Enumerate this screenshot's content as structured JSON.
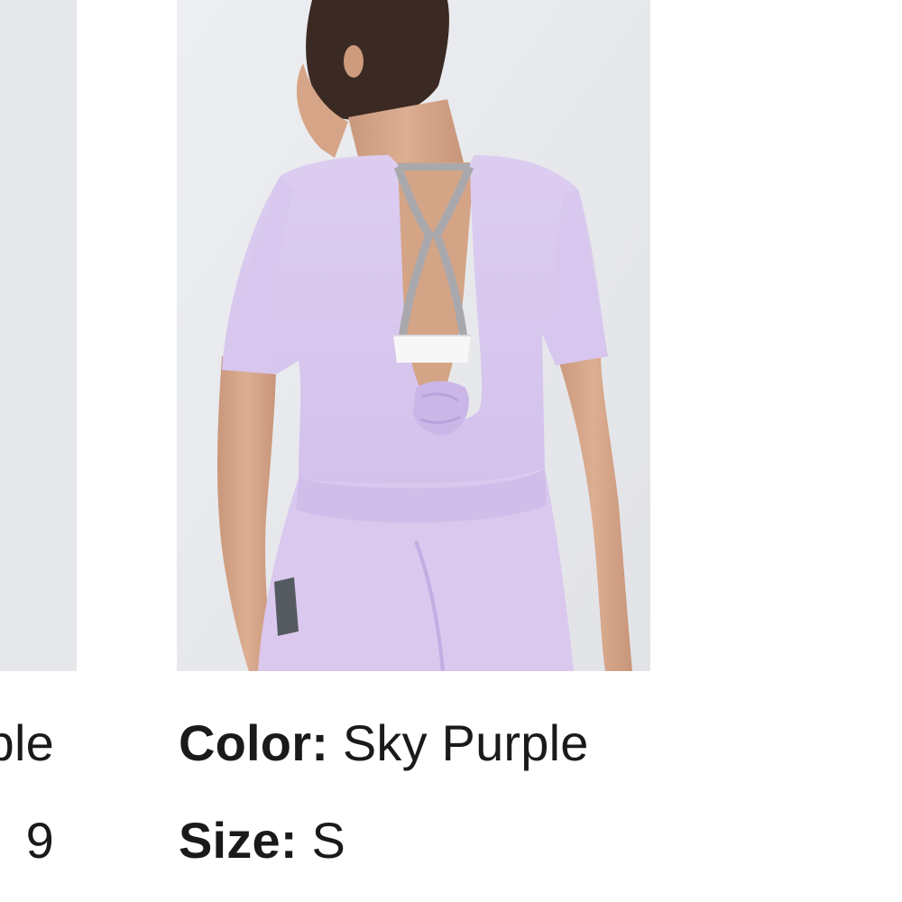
{
  "left_card": {
    "color_value_fragment": "ple",
    "size_value_fragment": "9"
  },
  "main_card": {
    "image_alt": "Woman wearing lavender open-back twist t-shirt and matching leggings, back view",
    "color_label": "Color:",
    "color_value": "Sky Purple",
    "size_label": "Size:",
    "size_value": "S"
  },
  "colors": {
    "garment": "#d9c9ee",
    "photo_background": "#e8e9ec",
    "text": "#1a1a1a"
  }
}
